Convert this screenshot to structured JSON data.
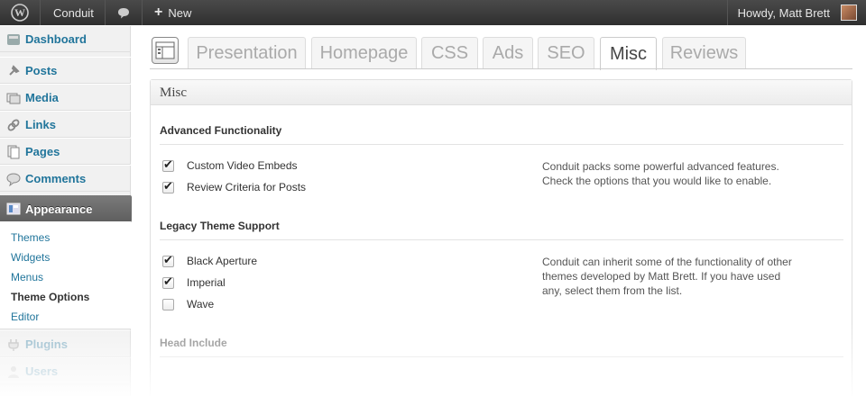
{
  "admin_bar": {
    "site_name": "Conduit",
    "new_label": "New",
    "howdy": "Howdy, Matt Brett",
    "icons": [
      "wordpress-logo-icon",
      "comments-icon",
      "plus-icon",
      "avatar"
    ]
  },
  "sidebar": {
    "items": [
      {
        "label": "Dashboard",
        "icon": "dashboard-icon"
      },
      {
        "label": "Posts",
        "icon": "pin-icon"
      },
      {
        "label": "Media",
        "icon": "media-icon"
      },
      {
        "label": "Links",
        "icon": "link-icon"
      },
      {
        "label": "Pages",
        "icon": "pages-icon"
      },
      {
        "label": "Comments",
        "icon": "comments-icon"
      },
      {
        "label": "Appearance",
        "icon": "appearance-icon"
      },
      {
        "label": "Plugins",
        "icon": "plugins-icon"
      },
      {
        "label": "Users",
        "icon": "users-icon"
      }
    ],
    "submenu": [
      "Themes",
      "Widgets",
      "Menus",
      "Theme Options",
      "Editor"
    ]
  },
  "tabs": [
    "Presentation",
    "Homepage",
    "CSS",
    "Ads",
    "SEO",
    "Misc",
    "Reviews"
  ],
  "panel": {
    "title": "Misc",
    "sections": [
      {
        "title": "Advanced Functionality",
        "options": [
          {
            "label": "Custom Video Embeds",
            "checked": true
          },
          {
            "label": "Review Criteria for Posts",
            "checked": true
          }
        ],
        "description_lines": [
          "Conduit packs some powerful advanced features.",
          "Check the options that you would like to enable."
        ]
      },
      {
        "title": "Legacy Theme Support",
        "options": [
          {
            "label": "Black Aperture",
            "checked": true
          },
          {
            "label": "Imperial",
            "checked": true
          },
          {
            "label": "Wave",
            "checked": false
          }
        ],
        "description_lines": [
          "Conduit can inherit some of the functionality of other",
          "themes developed by Matt Brett. If you have used",
          "any, select them from the list."
        ]
      },
      {
        "title": "Head Include"
      }
    ]
  },
  "colors": {
    "link": "#21759b",
    "admin_bar": "#3a3a3a",
    "active_menu": "#6b6b6b"
  }
}
